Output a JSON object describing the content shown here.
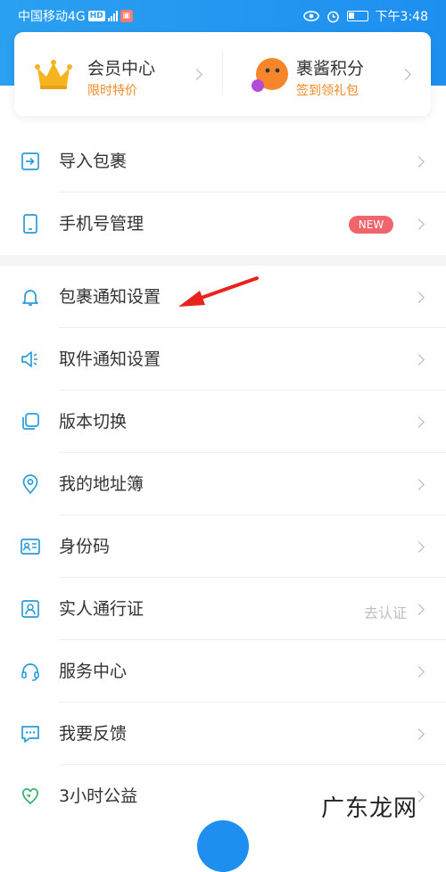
{
  "status_bar": {
    "carrier": "中国移动4G",
    "hd": "HD",
    "time": "下午3:48"
  },
  "member_card": {
    "left": {
      "title": "会员中心",
      "subtitle": "限时特价",
      "icon": "crown-icon"
    },
    "right": {
      "title": "裹酱积分",
      "subtitle": "签到领礼包",
      "icon": "mascot-icon"
    }
  },
  "menu": {
    "group1": [
      {
        "label": "导入包裹",
        "icon": "import-icon"
      },
      {
        "label": "手机号管理",
        "icon": "phone-icon",
        "badge": "NEW"
      }
    ],
    "group2": [
      {
        "label": "包裹通知设置",
        "icon": "bell-icon"
      },
      {
        "label": "取件通知设置",
        "icon": "speaker-icon"
      },
      {
        "label": "版本切换",
        "icon": "switch-icon"
      },
      {
        "label": "我的地址簿",
        "icon": "location-icon"
      },
      {
        "label": "身份码",
        "icon": "id-card-icon"
      },
      {
        "label": "实人通行证",
        "icon": "person-icon",
        "hint": "去认证"
      },
      {
        "label": "服务中心",
        "icon": "headset-icon"
      },
      {
        "label": "我要反馈",
        "icon": "feedback-icon"
      },
      {
        "label": "3小时公益",
        "icon": "charity-icon"
      }
    ]
  },
  "watermark": "广东龙网",
  "colors": {
    "brand_blue": "#1e8ff0",
    "icon_blue": "#2a9cd8",
    "accent_orange": "#f08a24",
    "badge_red": "#f0656b",
    "annotation_red": "#e8231e"
  }
}
